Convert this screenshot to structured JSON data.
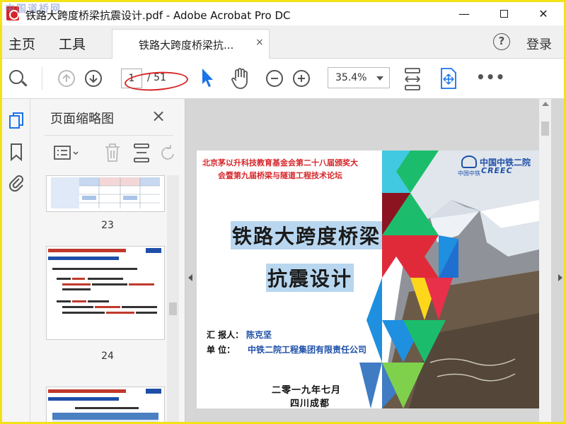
{
  "window": {
    "title": "铁路大跨度桥梁抗震设计.pdf - Adobe Acrobat Pro DC",
    "watermark": "中国道桥网",
    "minimize": "—",
    "close": "✕"
  },
  "tabs": {
    "home": "主页",
    "tools": "工具",
    "doc_tab": "铁路大跨度桥梁抗...",
    "doc_close": "×",
    "help": "?",
    "login": "登录"
  },
  "toolbar": {
    "current_page": "1",
    "page_total": "/ 51",
    "zoom": "35.4%",
    "more": "•••"
  },
  "panel": {
    "title": "页面缩略图",
    "close": "×",
    "thumbnails": [
      {
        "label": "23"
      },
      {
        "label": "24"
      }
    ]
  },
  "slide": {
    "header_line1": "北京茅以升科技教育基金会第二十八届颁奖大",
    "header_line2": "会暨第九届桥梁与隧道工程技术论坛",
    "logo_cn": "中国中铁二院",
    "logo_en": "CREEC",
    "logo_sub": "中国中铁",
    "title_line1": "铁路大跨度桥梁",
    "title_line2": "抗震设计",
    "reporter_label": "汇 报人：",
    "reporter": "陈克坚",
    "unit_label": "单    位：",
    "unit": "中铁二院工程集团有限责任公司",
    "date": "二零一九年七月",
    "place": "四川成都"
  },
  "colors": {
    "accent_red": "#d6262a",
    "brand_blue": "#1e4fa8",
    "toolbar_blue": "#1a73e8",
    "highlight_ellipse": "#d92626"
  }
}
